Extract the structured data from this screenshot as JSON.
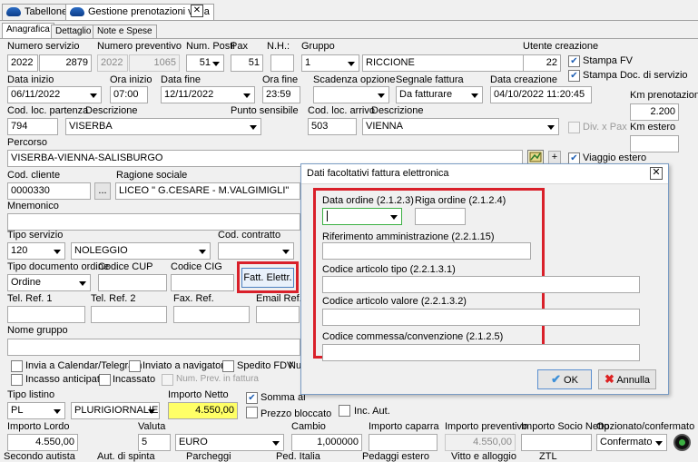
{
  "tabs": {
    "tab1": "Tabellone",
    "tab2": "Gestione prenotazioni varia",
    "close": "✕"
  },
  "subtabs": {
    "anagrafica": "Anagrafica",
    "dettaglio": "Dettaglio",
    "note": "Note e Spese"
  },
  "form": {
    "labels": {
      "numero_servizio": "Numero servizio",
      "numero_preventivo": "Numero preventivo",
      "num_posti": "Num. Posti",
      "pax": "Pax",
      "nh": "N.H.:",
      "gruppo": "Gruppo",
      "utente_creazione": "Utente creazione",
      "stampa_fv": "Stampa FV",
      "stampa_doc": "Stampa Doc. di servizio",
      "data_inizio": "Data inizio",
      "ora_inizio": "Ora inizio",
      "data_fine": "Data fine",
      "ora_fine": "Ora fine",
      "scadenza_opzione": "Scadenza opzione",
      "segnale_fattura": "Segnale fattura",
      "data_creazione": "Data creazione",
      "km_prenotazione": "Km prenotazione",
      "cod_loc_partenza": "Cod. loc. partenza",
      "descrizione1": "Descrizione",
      "punto_sensibile": "Punto sensibile",
      "cod_loc_arrivo": "Cod. loc. arrivo",
      "descrizione2": "Descrizione",
      "div_pax": "Div. x Pax",
      "km_estero": "Km estero",
      "percorso": "Percorso",
      "viaggio_estero": "Viaggio estero",
      "cod_cliente": "Cod. cliente",
      "ragione_sociale": "Ragione sociale",
      "mnemonico": "Mnemonico",
      "tipo_servizio": "Tipo servizio",
      "cod_contratto": "Cod. contratto",
      "tipo_documento_ordine": "Tipo documento ordine",
      "codice_cup": "Codice CUP",
      "codice_cig": "Codice CIG",
      "tel_ref1": "Tel. Ref. 1",
      "tel_ref2": "Tel. Ref. 2",
      "fax_ref": "Fax. Ref.",
      "email_ref": "Email Ref.",
      "nome_gruppo": "Nome gruppo",
      "invia_calendar": "Invia a Calendar/Telegram",
      "inviato_navigatore": "Inviato a navigatore",
      "spedito_fdv": "Spedito FDV",
      "nu": "Nu",
      "incasso_anticipato": "Incasso anticipato",
      "incassato": "Incassato",
      "num_prev_fattura": "Num. Prev. in fattura",
      "tipo_listino": "Tipo listino",
      "importo_netto": "Importo Netto",
      "somma_al": "Somma al",
      "prezzo_bloccato": "Prezzo bloccato",
      "inc_aut": "Inc. Aut.",
      "importo_lordo": "Importo Lordo",
      "valuta": "Valuta",
      "cambio": "Cambio",
      "importo_caparra": "Importo caparra",
      "importo_preventivo": "Importo preventivo",
      "importo_socio_netto": "Importo Socio Netto",
      "opzionato_confermato": "Opzionato/confermato",
      "secondo_autista": "Secondo autista",
      "aut_spinta": "Aut. di spinta",
      "parcheggi": "Parcheggi",
      "ped_italia": "Ped. Italia",
      "pedaggi_estero": "Pedaggi estero",
      "vitto_alloggio": "Vitto e alloggio",
      "ztl": "ZTL"
    },
    "values": {
      "anno": "2022",
      "numero": "2879",
      "prev_anno": "2022",
      "prev_numero": "1065",
      "num_posti": "51",
      "pax": "51",
      "nh": "",
      "gruppo_cod": "1",
      "gruppo_desc": "RICCIONE",
      "utente_creazione": "22",
      "data_inizio": "06/11/2022",
      "ora_inizio": "07:00",
      "data_fine": "12/11/2022",
      "ora_fine": "23:59",
      "scadenza_opzione": "",
      "segnale_fattura": "Da fatturare",
      "data_creazione": "04/10/2022 11:20:45",
      "km_prenotazione": "2.200",
      "cod_loc_partenza": "794",
      "desc_partenza": "VISERBA",
      "cod_loc_arrivo": "503",
      "desc_arrivo": "VIENNA",
      "km_estero": "",
      "percorso": "VISERBA-VIENNA-SALISBURGO",
      "cod_cliente": "0000330",
      "cliente_btn": "...",
      "ragione_sociale": "LICEO \" G.CESARE - M.VALGIMIGLI\"",
      "tipo_servizio_cod": "120",
      "tipo_servizio_desc": "NOLEGGIO",
      "tipo_documento": "Ordine",
      "tipo_listino": "PL",
      "listino_desc": "PLURIGIORNALIE",
      "importo_netto": "4.550,00",
      "importo_lordo": "4.550,00",
      "valuta_cod": "5",
      "valuta_desc": "EURO",
      "cambio": "1,000000",
      "importo_preventivo": "4.550,00",
      "opzionato": "Confermato"
    },
    "checks": {
      "stampa_fv": true,
      "stampa_doc": true,
      "viaggio_estero": true,
      "somma_al": true
    },
    "fatt_button": "Fatt. Elettr."
  },
  "dialog": {
    "title": "Dati facoltativi fattura elettronica",
    "close": "✕",
    "data_ordine": "Data ordine (2.1.2.3)",
    "riga_ordine": "Riga ordine (2.1.2.4)",
    "riferimento": "Riferimento amministrazione (2.2.1.15)",
    "art_tipo": "Codice articolo tipo (2.2.1.3.1)",
    "art_valore": "Codice articolo valore (2.2.1.3.2)",
    "commessa": "Codice commessa/convenzione (2.1.2.5)",
    "ok": "OK",
    "annulla": "Annulla"
  },
  "colors": {
    "highlight": "#d9202a",
    "yellow_field": "#ffff66",
    "focus_green": "#3cb043"
  }
}
